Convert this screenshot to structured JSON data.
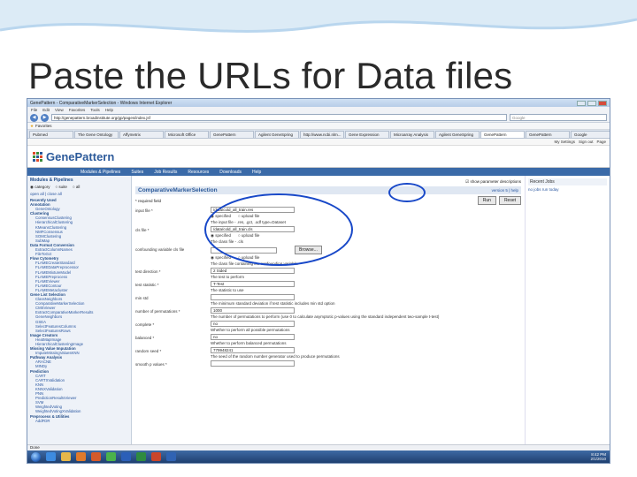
{
  "slide": {
    "title": "Paste the URLs for Data files"
  },
  "browser": {
    "window_title": "GenePattern - ComparativeMarkerSelection - Windows Internet Explorer",
    "menu": [
      "File",
      "Edit",
      "View",
      "Favorites",
      "Tools",
      "Help"
    ],
    "address": "http://genepattern.broadinstitute.org/gp/pages/index.jsf",
    "search_placeholder": "Google",
    "favorites_label": "Favorites",
    "tabs": [
      "Pubmed",
      "The Gene Ontology",
      "Affymetrix",
      "Microsoft Office",
      "GenePattern",
      "Agilent GeneSpring",
      "http://www.ncbi.nlm...",
      "Gene Expression",
      "Microarray Analysis",
      "Agilent GeneSpring",
      "GenePattern",
      "GenePattern",
      "Google"
    ],
    "active_tab_index": 10,
    "toolbar_links": [
      "My Settings",
      "Sign out",
      "Page"
    ],
    "status": "Done"
  },
  "gp": {
    "logo": "GenePattern",
    "user": "Current Jobs",
    "nav": [
      "Modules & Pipelines",
      "Suites",
      "Job Results",
      "Resources",
      "Downloads",
      "Help"
    ],
    "sidebar": {
      "header": "Modules & Pipelines",
      "radios": [
        "category",
        "suite",
        "all"
      ],
      "expand": "open all | close all",
      "items": [
        {
          "label": "Recently Used",
          "kind": "cat"
        },
        {
          "label": "Annotation",
          "kind": "cat"
        },
        {
          "label": "GeneOntology",
          "kind": "sub"
        },
        {
          "label": "Clustering",
          "kind": "cat"
        },
        {
          "label": "ConsensusClustering",
          "kind": "sub"
        },
        {
          "label": "HierarchicalClustering",
          "kind": "sub"
        },
        {
          "label": "KMeansClustering",
          "kind": "sub"
        },
        {
          "label": "NMFConsensus",
          "kind": "sub"
        },
        {
          "label": "SOMClustering",
          "kind": "sub"
        },
        {
          "label": "SubMap",
          "kind": "sub"
        },
        {
          "label": "Data Format Conversion",
          "kind": "cat"
        },
        {
          "label": "ExtractColumnNames",
          "kind": "sub"
        },
        {
          "label": "FileToGct",
          "kind": "sub"
        },
        {
          "label": "Flow Cytometry",
          "kind": "cat"
        },
        {
          "label": "FLAMECreateStandard",
          "kind": "sub"
        },
        {
          "label": "FLAMEDataPreprocessor",
          "kind": "sub"
        },
        {
          "label": "FLAMEMixtureModel",
          "kind": "sub"
        },
        {
          "label": "FLAMEPreprocess",
          "kind": "sub"
        },
        {
          "label": "FLAMEViewer",
          "kind": "sub"
        },
        {
          "label": "FLAMEContour",
          "kind": "sub"
        },
        {
          "label": "FLAMEMetacluster",
          "kind": "sub"
        },
        {
          "label": "Gene List Selection",
          "kind": "cat"
        },
        {
          "label": "ClassNeighbors",
          "kind": "sub"
        },
        {
          "label": "ComparativeMarkerSelection",
          "kind": "sub"
        },
        {
          "label": "CMSViewer",
          "kind": "sub"
        },
        {
          "label": "ExtractComparativeMarkerResults",
          "kind": "sub"
        },
        {
          "label": "GeneNeighbors",
          "kind": "sub"
        },
        {
          "label": "GSEA",
          "kind": "sub"
        },
        {
          "label": "SelectFeaturesColumns",
          "kind": "sub"
        },
        {
          "label": "SelectFeaturesRows",
          "kind": "sub"
        },
        {
          "label": "Image Creators",
          "kind": "cat"
        },
        {
          "label": "HeatMapImage",
          "kind": "sub"
        },
        {
          "label": "HierarchicalClusteringImage",
          "kind": "sub"
        },
        {
          "label": "Missing Value Imputation",
          "kind": "cat"
        },
        {
          "label": "ImputeMissingValuesKNN",
          "kind": "sub"
        },
        {
          "label": "Pathway Analysis",
          "kind": "cat"
        },
        {
          "label": "ARACNE",
          "kind": "sub"
        },
        {
          "label": "MINDy",
          "kind": "sub"
        },
        {
          "label": "Prediction",
          "kind": "cat"
        },
        {
          "label": "CART",
          "kind": "sub"
        },
        {
          "label": "CARTXValidation",
          "kind": "sub"
        },
        {
          "label": "KNN",
          "kind": "sub"
        },
        {
          "label": "KNNXValidation",
          "kind": "sub"
        },
        {
          "label": "PNN",
          "kind": "sub"
        },
        {
          "label": "PredictionResultsViewer",
          "kind": "sub"
        },
        {
          "label": "SVM",
          "kind": "sub"
        },
        {
          "label": "WeightedVoting",
          "kind": "sub"
        },
        {
          "label": "WeightedVotingXValidation",
          "kind": "sub"
        },
        {
          "label": "Preprocess & Utilities",
          "kind": "cat"
        },
        {
          "label": "AddFDR",
          "kind": "sub"
        }
      ]
    },
    "content": {
      "show_label": "show parameter descriptions",
      "module_title": "ComparativeMarkerSelection",
      "module_links": "version 5 | help",
      "required_note": "* required field",
      "run_label": "Run",
      "reset_label": "Reset",
      "params": [
        {
          "label": "input file *",
          "value": "/data/cold_all_train.res",
          "radios": [
            "specified",
            "upload file"
          ],
          "desc": "The input file - .res, .gct, .odf type=Dataset"
        },
        {
          "label": "cls file *",
          "value": "/data/cold_all_train.cls",
          "radios": [
            "specified",
            "upload file"
          ],
          "desc": "The class file - .cls"
        },
        {
          "label": "confounding variable cls file",
          "value": "",
          "browse": "Browse...",
          "radios": [
            "specified",
            "upload file"
          ],
          "desc": "The class file containing the confounding variable."
        },
        {
          "label": "test direction *",
          "value": "2 Sided",
          "desc": "The test to perform"
        },
        {
          "label": "test statistic *",
          "value": "T-Test",
          "desc": "The statistic to use"
        },
        {
          "label": "min std",
          "value": "",
          "desc": "The minimum standard deviation if test statistic includes min std option"
        },
        {
          "label": "number of permutations *",
          "value": "1000",
          "desc": "The number of permutations to perform (use 0 to calculate asymptotic p-values using the standard independent two-sample t-test)"
        },
        {
          "label": "complete *",
          "value": "no",
          "desc": "Whether to perform all possible permutations"
        },
        {
          "label": "balanced *",
          "value": "no",
          "desc": "Whether to perform balanced permutations"
        },
        {
          "label": "random seed *",
          "value": "779948241",
          "desc": "The seed of the random number generator used to produce permutations"
        },
        {
          "label": "smooth p values *",
          "value": "",
          "desc": ""
        }
      ]
    },
    "rightpanel": {
      "header": "Recent Jobs",
      "link": "no jobs run today"
    }
  },
  "taskbar": {
    "time": "8:42 PM",
    "date": "2/1/2010"
  },
  "colors": {
    "highlight": "#1848c8",
    "gp_blue": "#3a6aa8",
    "taskbar": "#1f3f70"
  }
}
